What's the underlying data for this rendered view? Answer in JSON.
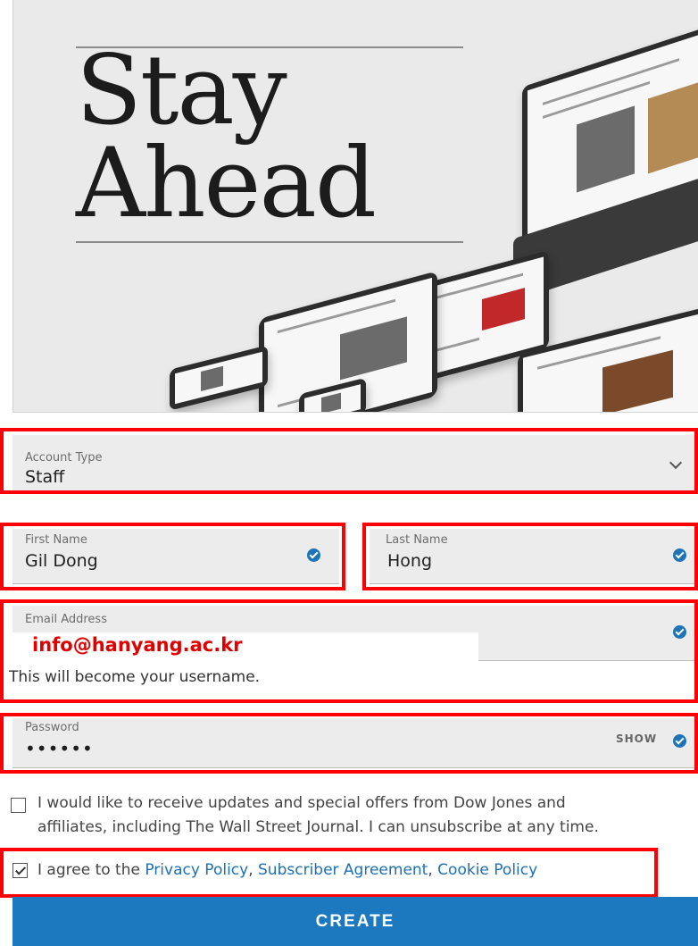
{
  "hero": {
    "title_line1": "Stay",
    "title_line2": "Ahead"
  },
  "account_type": {
    "label": "Account Type",
    "value": "Staff"
  },
  "first_name": {
    "label": "First Name",
    "value": "Gil Dong"
  },
  "last_name": {
    "label": "Last Name",
    "value": "Hong"
  },
  "email": {
    "label": "Email Address",
    "value": "info@hanyang.ac.kr",
    "hint": "This will become your username."
  },
  "password": {
    "label": "Password",
    "value": "••••••",
    "show_label": "SHOW"
  },
  "marketing_opt_in": {
    "checked": false,
    "text_line1": "I would like to receive updates and special offers from Dow Jones and",
    "text_line2": "affiliates, including The Wall Street Journal. I can unsubscribe at any time."
  },
  "terms": {
    "checked": true,
    "prefix": "I agree to the ",
    "privacy_policy": "Privacy Policy",
    "sep1": ", ",
    "subscriber_agreement": "Subscriber Agreement",
    "sep2": ", ",
    "cookie_policy": "Cookie Policy"
  },
  "create_button": "CREATE",
  "colors": {
    "accent": "#1d79bf",
    "annotation_red": "#ff0000"
  }
}
